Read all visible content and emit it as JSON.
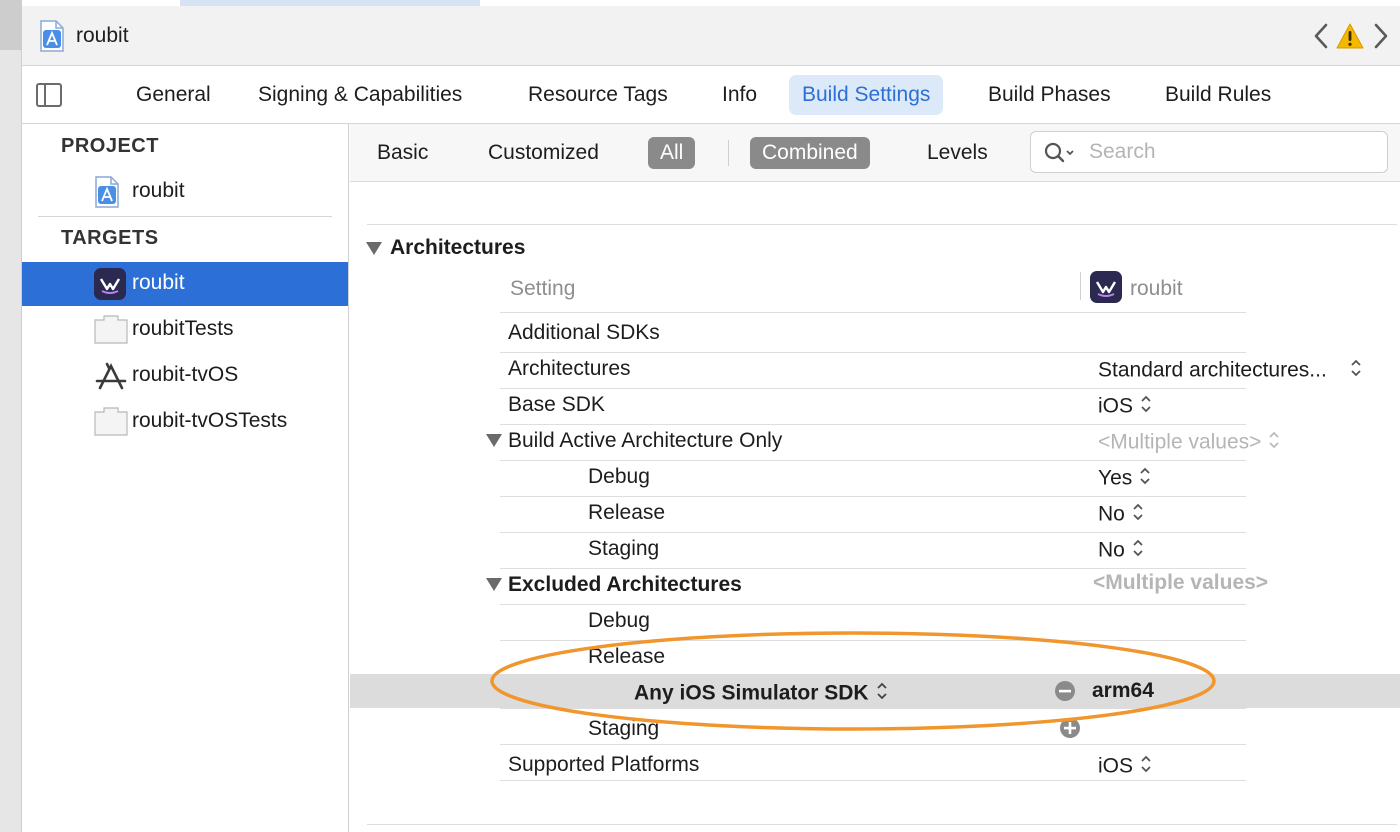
{
  "window": {
    "title": "roubit"
  },
  "colors": {
    "accent": "#2c6fd6",
    "warning": "#f5b800",
    "annotation": "#f0962d"
  },
  "tabs": [
    {
      "label": "General"
    },
    {
      "label": "Signing & Capabilities"
    },
    {
      "label": "Resource Tags"
    },
    {
      "label": "Info"
    },
    {
      "label": "Build Settings",
      "active": true
    },
    {
      "label": "Build Phases"
    },
    {
      "label": "Build Rules"
    }
  ],
  "sidebar": {
    "project_header": "PROJECT",
    "project_item": "roubit",
    "targets_header": "TARGETS",
    "targets": [
      {
        "label": "roubit",
        "icon": "roubit-app-icon",
        "selected": true
      },
      {
        "label": "roubitTests",
        "icon": "test-bundle-icon"
      },
      {
        "label": "roubit-tvOS",
        "icon": "app-store-icon"
      },
      {
        "label": "roubit-tvOSTests",
        "icon": "test-bundle-icon"
      }
    ]
  },
  "filter": {
    "basic": "Basic",
    "customized": "Customized",
    "all": "All",
    "combined": "Combined",
    "levels": "Levels",
    "search_placeholder": "Search",
    "search_value": ""
  },
  "settings": {
    "section": "Architectures",
    "col_setting": "Setting",
    "col_target": "roubit",
    "rows": {
      "additional_sdks": {
        "label": "Additional SDKs",
        "value": ""
      },
      "architectures": {
        "label": "Architectures",
        "value": "Standard architectures..."
      },
      "base_sdk": {
        "label": "Base SDK",
        "value": "iOS"
      },
      "build_active_arch": {
        "label": "Build Active Architecture Only",
        "value": "<Multiple values>"
      },
      "baa_debug": {
        "label": "Debug",
        "value": "Yes"
      },
      "baa_release": {
        "label": "Release",
        "value": "No"
      },
      "baa_staging": {
        "label": "Staging",
        "value": "No"
      },
      "excluded_arch": {
        "label": "Excluded Architectures",
        "value": "<Multiple values>"
      },
      "ex_debug": {
        "label": "Debug",
        "value": ""
      },
      "ex_release": {
        "label": "Release",
        "value": ""
      },
      "ex_any_sim": {
        "label": "Any iOS Simulator SDK",
        "value": "arm64"
      },
      "ex_staging": {
        "label": "Staging",
        "value": ""
      },
      "supported_platforms": {
        "label": "Supported Platforms",
        "value": "iOS"
      }
    }
  }
}
